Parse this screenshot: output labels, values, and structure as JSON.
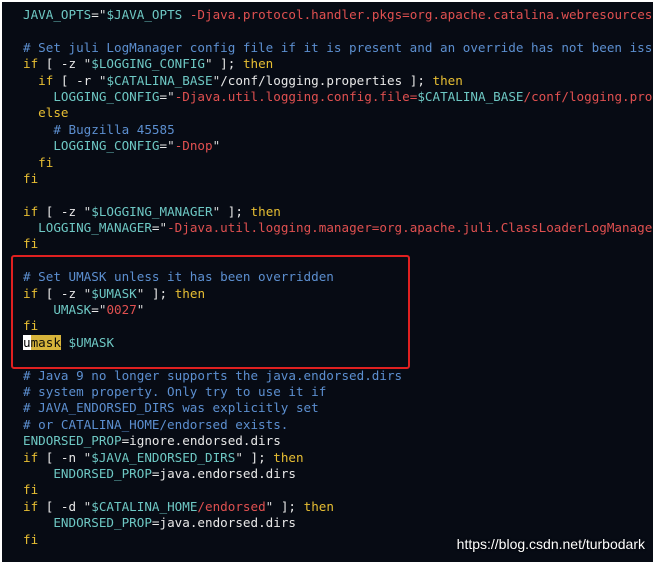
{
  "editor": {
    "lines": [
      [
        "JAVA_OPTS=\"$JAVA_OPTS -Djava.protocol.handler.pkgs=org.apache.catalina.webresources\""
      ],
      [
        ""
      ],
      [
        "# Set juli LogManager config file if it is present and an override has not been issued"
      ],
      [
        "if [ -z \"$LOGGING_CONFIG\" ]; then"
      ],
      [
        "  if [ -r \"$CATALINA_BASE\"/conf/logging.properties ]; then"
      ],
      [
        "    LOGGING_CONFIG=\"-Djava.util.logging.config.file=$CATALINA_BASE/conf/logging.properties\""
      ],
      [
        "  else"
      ],
      [
        "    # Bugzilla 45585"
      ],
      [
        "    LOGGING_CONFIG=\"-Dnop\""
      ],
      [
        "  fi"
      ],
      [
        "fi"
      ],
      [
        ""
      ],
      [
        "if [ -z \"$LOGGING_MANAGER\" ]; then"
      ],
      [
        "  LOGGING_MANAGER=\"-Djava.util.logging.manager=org.apache.juli.ClassLoaderLogManager\""
      ],
      [
        "fi"
      ],
      [
        ""
      ],
      [
        "# Set UMASK unless it has been overridden"
      ],
      [
        "if [ -z \"$UMASK\" ]; then"
      ],
      [
        "    UMASK=\"0027\""
      ],
      [
        "fi"
      ],
      [
        "umask $UMASK"
      ],
      [
        ""
      ],
      [
        "# Java 9 no longer supports the java.endorsed.dirs"
      ],
      [
        "# system property. Only try to use it if"
      ],
      [
        "# JAVA_ENDORSED_DIRS was explicitly set"
      ],
      [
        "# or CATALINA_HOME/endorsed exists."
      ],
      [
        "ENDORSED_PROP=ignore.endorsed.dirs"
      ],
      [
        "if [ -n \"$JAVA_ENDORSED_DIRS\" ]; then"
      ],
      [
        "    ENDORSED_PROP=java.endorsed.dirs"
      ],
      [
        "fi"
      ],
      [
        "if [ -d \"$CATALINA_HOME/endorsed\" ]; then"
      ],
      [
        "    ENDORSED_PROP=java.endorsed.dirs"
      ],
      [
        "fi"
      ]
    ]
  },
  "tokens": [
    [
      [
        "var",
        "JAVA_OPTS"
      ],
      [
        "plain",
        "="
      ],
      [
        "str",
        "\""
      ],
      [
        "var",
        "$JAVA_OPTS"
      ],
      [
        "err",
        " -Djava.protocol.handler.pkgs=org.apache.catalina.webresources"
      ],
      [
        "str",
        "\""
      ]
    ],
    [],
    [
      [
        "com",
        "# Set juli LogManager config file if it is present and an override has not been issued"
      ]
    ],
    [
      [
        "kw",
        "if"
      ],
      [
        "plain",
        " [ -z "
      ],
      [
        "str",
        "\""
      ],
      [
        "var",
        "$LOGGING_CONFIG"
      ],
      [
        "str",
        "\""
      ],
      [
        "plain",
        " ]; "
      ],
      [
        "kw",
        "then"
      ]
    ],
    [
      [
        "plain",
        "  "
      ],
      [
        "kw",
        "if"
      ],
      [
        "plain",
        " [ -r "
      ],
      [
        "str",
        "\""
      ],
      [
        "var",
        "$CATALINA_BASE"
      ],
      [
        "str",
        "\""
      ],
      [
        "plain",
        "/conf/logging.properties ]; "
      ],
      [
        "kw",
        "then"
      ]
    ],
    [
      [
        "plain",
        "    "
      ],
      [
        "var",
        "LOGGING_CONFIG"
      ],
      [
        "plain",
        "="
      ],
      [
        "str",
        "\""
      ],
      [
        "err",
        "-Djava.util.logging.config.file="
      ],
      [
        "var",
        "$CATALINA_BASE"
      ],
      [
        "err",
        "/conf/logging.properties"
      ],
      [
        "str",
        "\""
      ]
    ],
    [
      [
        "plain",
        "  "
      ],
      [
        "kw",
        "else"
      ]
    ],
    [
      [
        "plain",
        "    "
      ],
      [
        "com",
        "# Bugzilla 45585"
      ]
    ],
    [
      [
        "plain",
        "    "
      ],
      [
        "var",
        "LOGGING_CONFIG"
      ],
      [
        "plain",
        "="
      ],
      [
        "str",
        "\""
      ],
      [
        "err",
        "-Dnop"
      ],
      [
        "str",
        "\""
      ]
    ],
    [
      [
        "plain",
        "  "
      ],
      [
        "kw",
        "fi"
      ]
    ],
    [
      [
        "kw",
        "fi"
      ]
    ],
    [],
    [
      [
        "kw",
        "if"
      ],
      [
        "plain",
        " [ -z "
      ],
      [
        "str",
        "\""
      ],
      [
        "var",
        "$LOGGING_MANAGER"
      ],
      [
        "str",
        "\""
      ],
      [
        "plain",
        " ]; "
      ],
      [
        "kw",
        "then"
      ]
    ],
    [
      [
        "plain",
        "  "
      ],
      [
        "var",
        "LOGGING_MANAGER"
      ],
      [
        "plain",
        "="
      ],
      [
        "str",
        "\""
      ],
      [
        "err",
        "-Djava.util.logging.manager=org.apache.juli.ClassLoaderLogManager"
      ],
      [
        "str",
        "\""
      ]
    ],
    [
      [
        "kw",
        "fi"
      ]
    ],
    [],
    [
      [
        "com",
        "# Set UMASK unless it has been overridden"
      ]
    ],
    [
      [
        "kw",
        "if"
      ],
      [
        "plain",
        " [ -z "
      ],
      [
        "str",
        "\""
      ],
      [
        "var",
        "$UMASK"
      ],
      [
        "str",
        "\""
      ],
      [
        "plain",
        " ]; "
      ],
      [
        "kw",
        "then"
      ]
    ],
    [
      [
        "plain",
        "    "
      ],
      [
        "var",
        "UMASK"
      ],
      [
        "plain",
        "="
      ],
      [
        "str",
        "\""
      ],
      [
        "err",
        "0027"
      ],
      [
        "str",
        "\""
      ]
    ],
    [
      [
        "kw",
        "fi"
      ]
    ],
    [
      [
        "cursor",
        "u"
      ],
      [
        "hl-word",
        "mask"
      ],
      [
        "plain",
        " "
      ],
      [
        "var",
        "$UMASK"
      ]
    ],
    [],
    [
      [
        "com",
        "# Java 9 no longer supports the java.endorsed.dirs"
      ]
    ],
    [
      [
        "com",
        "# system property. Only try to use it if"
      ]
    ],
    [
      [
        "com",
        "# JAVA_ENDORSED_DIRS was explicitly set"
      ]
    ],
    [
      [
        "com",
        "# or CATALINA_HOME/endorsed exists."
      ]
    ],
    [
      [
        "var",
        "ENDORSED_PROP"
      ],
      [
        "plain",
        "=ignore.endorsed.dirs"
      ]
    ],
    [
      [
        "kw",
        "if"
      ],
      [
        "plain",
        " [ -n "
      ],
      [
        "str",
        "\""
      ],
      [
        "var",
        "$JAVA_ENDORSED_DIRS"
      ],
      [
        "str",
        "\""
      ],
      [
        "plain",
        " ]; "
      ],
      [
        "kw",
        "then"
      ]
    ],
    [
      [
        "plain",
        "    "
      ],
      [
        "var",
        "ENDORSED_PROP"
      ],
      [
        "plain",
        "=java.endorsed.dirs"
      ]
    ],
    [
      [
        "kw",
        "fi"
      ]
    ],
    [
      [
        "kw",
        "if"
      ],
      [
        "plain",
        " [ -d "
      ],
      [
        "str",
        "\""
      ],
      [
        "var",
        "$CATALINA_HOME"
      ],
      [
        "err",
        "/endorsed"
      ],
      [
        "str",
        "\""
      ],
      [
        "plain",
        " ]; "
      ],
      [
        "kw",
        "then"
      ]
    ],
    [
      [
        "plain",
        "    "
      ],
      [
        "var",
        "ENDORSED_PROP"
      ],
      [
        "plain",
        "=java.endorsed.dirs"
      ]
    ],
    [
      [
        "kw",
        "fi"
      ]
    ]
  ],
  "watermark": "https://blog.csdn.net/turbodark",
  "colors": {
    "background": "#070b14",
    "keyword": "#e8bf33",
    "variable": "#6ec8c4",
    "string_value": "#e05050",
    "comment": "#5c8fd0",
    "highlight_box": "#e02020",
    "search_highlight": "#d7b43b"
  }
}
